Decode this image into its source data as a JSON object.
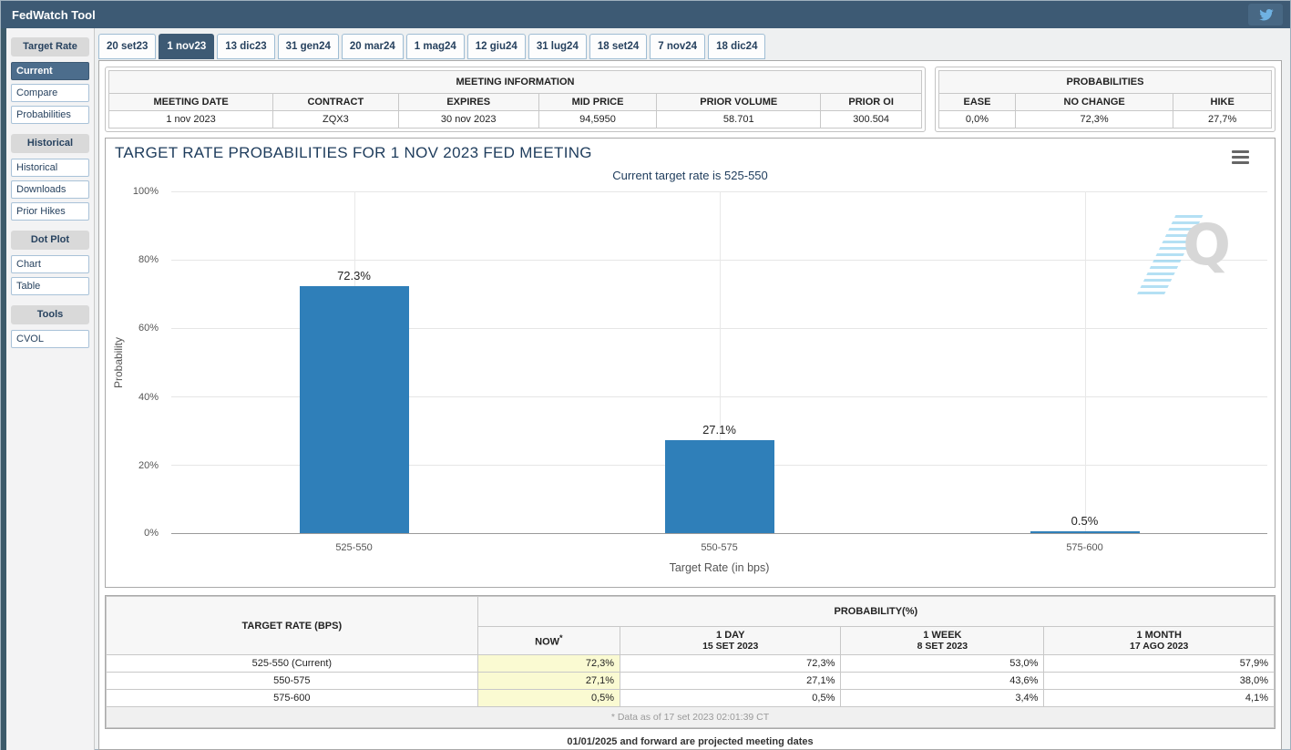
{
  "topbar": {
    "title": "FedWatch Tool"
  },
  "tabs": {
    "items": [
      {
        "label": "20 set23",
        "selected": false
      },
      {
        "label": "1 nov23",
        "selected": true
      },
      {
        "label": "13 dic23",
        "selected": false
      },
      {
        "label": "31 gen24",
        "selected": false
      },
      {
        "label": "20 mar24",
        "selected": false
      },
      {
        "label": "1 mag24",
        "selected": false
      },
      {
        "label": "12 giu24",
        "selected": false
      },
      {
        "label": "31 lug24",
        "selected": false
      },
      {
        "label": "18 set24",
        "selected": false
      },
      {
        "label": "7 nov24",
        "selected": false
      },
      {
        "label": "18 dic24",
        "selected": false
      }
    ]
  },
  "sidebar": {
    "groups": [
      {
        "header": "Target Rate",
        "items": [
          {
            "label": "Current",
            "selected": true
          },
          {
            "label": "Compare",
            "selected": false
          },
          {
            "label": "Probabilities",
            "selected": false
          }
        ]
      },
      {
        "header": "Historical",
        "items": [
          {
            "label": "Historical",
            "selected": false
          },
          {
            "label": "Downloads",
            "selected": false
          },
          {
            "label": "Prior Hikes",
            "selected": false
          }
        ]
      },
      {
        "header": "Dot Plot",
        "items": [
          {
            "label": "Chart",
            "selected": false
          },
          {
            "label": "Table",
            "selected": false
          }
        ]
      },
      {
        "header": "Tools",
        "items": [
          {
            "label": "CVOL",
            "selected": false
          }
        ]
      }
    ]
  },
  "meeting_info": {
    "title": "MEETING INFORMATION",
    "headers": [
      "MEETING DATE",
      "CONTRACT",
      "EXPIRES",
      "MID PRICE",
      "PRIOR VOLUME",
      "PRIOR OI"
    ],
    "values": [
      "1 nov 2023",
      "ZQX3",
      "30 nov 2023",
      "94,5950",
      "58.701",
      "300.504"
    ]
  },
  "probabilities_box": {
    "title": "PROBABILITIES",
    "headers": [
      "EASE",
      "NO CHANGE",
      "HIKE"
    ],
    "values": [
      "0,0%",
      "72,3%",
      "27,7%"
    ]
  },
  "chart_data": {
    "type": "bar",
    "title": "TARGET RATE PROBABILITIES FOR 1 NOV 2023 FED MEETING",
    "subtitle": "Current target rate is 525-550",
    "categories": [
      "525-550",
      "550-575",
      "575-600"
    ],
    "values": [
      72.3,
      27.1,
      0.5
    ],
    "labels": [
      "72.3%",
      "27.1%",
      "0.5%"
    ],
    "xlabel": "Target Rate (in bps)",
    "ylabel": "Probability",
    "ylim": [
      0,
      100
    ],
    "yticks": [
      "100%",
      "80%",
      "60%",
      "40%",
      "20%",
      "0%"
    ],
    "grid": true,
    "legend": "none",
    "bar_color": "#2f7fb9",
    "watermark": "Q"
  },
  "bottom_table": {
    "col_header": "TARGET RATE (BPS)",
    "group_header": "PROBABILITY(%)",
    "sub_headers": [
      {
        "line1": "NOW",
        "sup": "*",
        "line2": ""
      },
      {
        "line1": "1 DAY",
        "sup": "",
        "line2": "15 SET 2023"
      },
      {
        "line1": "1 WEEK",
        "sup": "",
        "line2": "8 SET 2023"
      },
      {
        "line1": "1 MONTH",
        "sup": "",
        "line2": "17 AGO 2023"
      }
    ],
    "rows": [
      {
        "rate": "525-550 (Current)",
        "now": "72,3%",
        "day": "72,3%",
        "week": "53,0%",
        "month": "57,9%"
      },
      {
        "rate": "550-575",
        "now": "27,1%",
        "day": "27,1%",
        "week": "43,6%",
        "month": "38,0%"
      },
      {
        "rate": "575-600",
        "now": "0,5%",
        "day": "0,5%",
        "week": "3,4%",
        "month": "4,1%"
      }
    ],
    "footnote": "* Data as of 17 set 2023 02:01:39 CT"
  },
  "footer": {
    "projected_note": "01/01/2025 and forward are projected meeting dates"
  },
  "colors": {
    "topbar_bg": "#3d5a74",
    "selected_item_bg": "#4c6d8c",
    "bar_blue": "#2f7fb9",
    "highlight_yellow": "#fafad2",
    "title_navy": "#1e3c5c",
    "twitter_blue": "#6fb2e2"
  }
}
